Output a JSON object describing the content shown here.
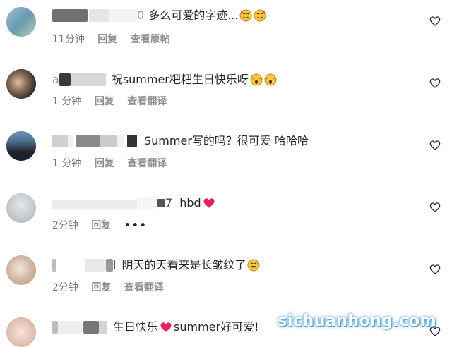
{
  "comments": [
    {
      "user_suffix": "0",
      "text": "多么可爱的字迹...",
      "emoji": [
        "smiling-face-with-hearts-icon",
        "smiling-face-with-hearts-icon"
      ],
      "time": "11分钟",
      "reply": "回复",
      "extra": "查看原帖",
      "avatar_color": "#7fb0c8"
    },
    {
      "user_prefix": "a",
      "text": "祝summer粑粑生日快乐呀",
      "emoji": [
        "screaming-face-icon",
        "screaming-face-icon"
      ],
      "time": "1 分钟",
      "reply": "回复",
      "extra": "查看翻译",
      "avatar_color": "#4a3d34"
    },
    {
      "text": "Summer写的吗？很可爱 哈哈哈",
      "emoji": [],
      "time": "1 分钟",
      "reply": "回复",
      "extra": "查看翻译",
      "avatar_color": "#2f3640"
    },
    {
      "user_suffix": "7",
      "text": "hbd",
      "emoji": [
        "red-heart-icon"
      ],
      "time": "2分钟",
      "reply": "回复",
      "extra": "•••",
      "avatar_color": "#c9cdd2"
    },
    {
      "user_suffix": "i",
      "text": "阴天的天看来是长皱纹了",
      "emoji": [
        "grinning-sweat-icon"
      ],
      "time": "2分钟",
      "reply": "回复",
      "extra": "查看翻译",
      "avatar_color": "#d8c7b8"
    },
    {
      "text_parts": [
        "生日快乐",
        "summer好可爱!"
      ],
      "emoji": [
        "red-heart-icon"
      ],
      "avatar_color": "#e6c9c0"
    }
  ],
  "watermark": "sichuanhong.com"
}
